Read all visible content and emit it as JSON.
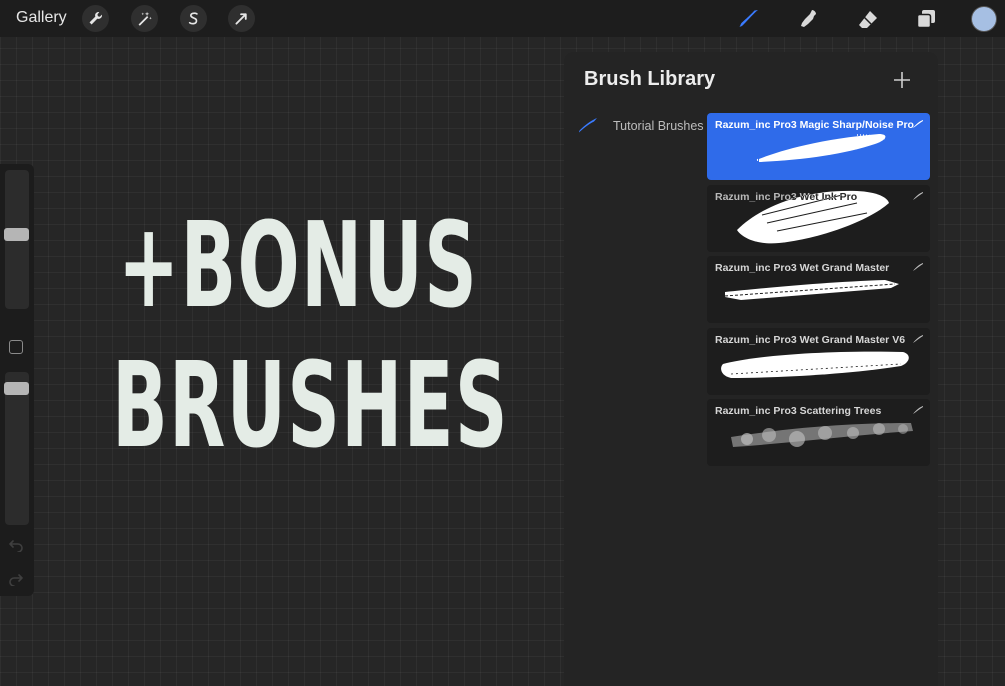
{
  "toolbar": {
    "gallery_label": "Gallery",
    "left_tools": [
      "wrench-icon",
      "magic-wand-icon",
      "selection-s-icon",
      "transform-arrow-icon"
    ],
    "right_tools": [
      "brush-icon",
      "smudge-icon",
      "eraser-icon",
      "layers-icon"
    ],
    "active_tool": "brush-icon",
    "current_color": "#a6bfe3",
    "accent_color": "#2f6bea"
  },
  "sidebar": {
    "size_slider_level": 0.42,
    "opacity_slider_level": 0.85,
    "icons": [
      "modify-square-icon",
      "undo-icon",
      "redo-icon"
    ]
  },
  "canvas": {
    "line1": "+BONUS",
    "line2": "BRUSHES"
  },
  "brush_library": {
    "title": "Brush Library",
    "add_icon": "plus-icon",
    "set": {
      "label": "Tutorial Brushes",
      "icon": "brush-set-icon"
    },
    "brushes": [
      {
        "name": "Razum_inc Pro3 Magic Sharp/Noise Pro",
        "selected": true
      },
      {
        "name": "Razum_inc Pro3 Wet Ink Pro",
        "selected": false
      },
      {
        "name": "Razum_inc Pro3 Wet Grand Master",
        "selected": false
      },
      {
        "name": "Razum_inc Pro3 Wet Grand Master V6",
        "selected": false
      },
      {
        "name": "Razum_inc Pro3 Scattering Trees",
        "selected": false
      }
    ]
  }
}
